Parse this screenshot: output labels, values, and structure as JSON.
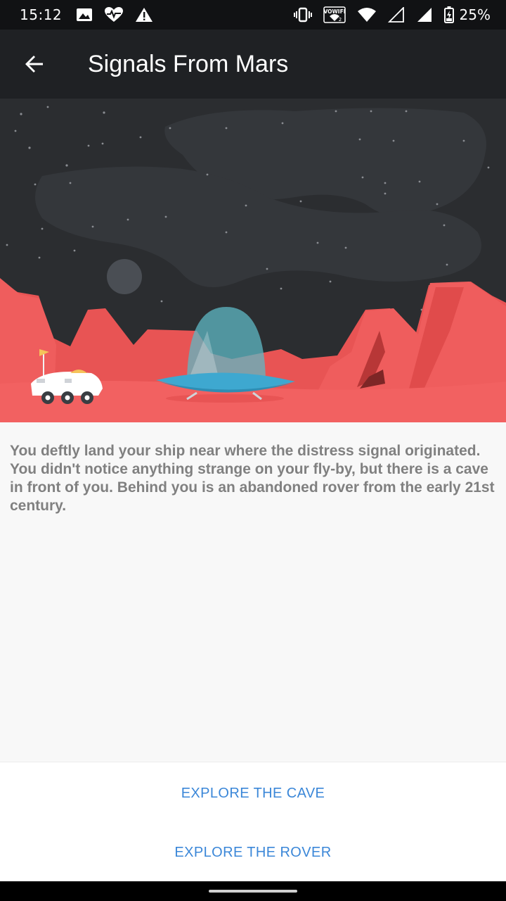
{
  "status_bar": {
    "time": "15:12",
    "battery_percent": "25%",
    "volte_label": "VOWIFI",
    "volte_sub": "2",
    "icons": [
      "gallery-icon",
      "heart-monitor-icon",
      "warning-icon",
      "vibrate-icon",
      "vowifi-icon",
      "wifi-icon",
      "signal-empty-icon",
      "signal-full-icon",
      "battery-charging-icon"
    ]
  },
  "app_bar": {
    "title": "Signals From Mars",
    "back_icon": "arrow-back-icon"
  },
  "hero": {
    "sky_color": "#2b2d30",
    "ground_color": "#f26161",
    "ship_color": "#3ea8d0",
    "rover_color": "#ffffff"
  },
  "story": {
    "text": "You deftly land your ship near where the distress signal originated. You didn't notice anything strange on your fly-by, but there is a cave in front of you. Behind you is an abandoned rover from the early 21st century."
  },
  "actions": {
    "cave_label": "EXPLORE THE CAVE",
    "rover_label": "EXPLORE THE ROVER",
    "accent_color": "#3b87d8"
  }
}
